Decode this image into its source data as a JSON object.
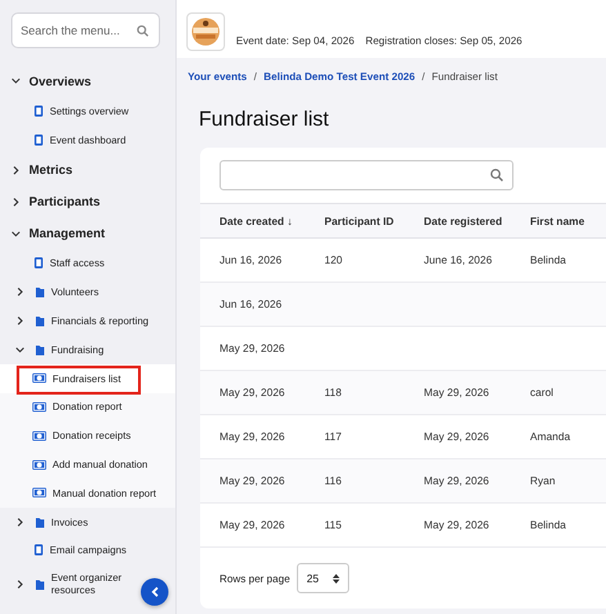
{
  "sidebar": {
    "search": {
      "placeholder": "Search the menu..."
    },
    "items": [
      {
        "label": "Overviews",
        "kind": "section",
        "expanded": true,
        "children": [
          {
            "label": "Settings overview",
            "kind": "link",
            "selected": false
          },
          {
            "label": "Event dashboard",
            "kind": "link",
            "selected": false
          }
        ]
      },
      {
        "label": "Metrics",
        "kind": "section",
        "expanded": false
      },
      {
        "label": "Participants",
        "kind": "section",
        "expanded": false
      },
      {
        "label": "Management",
        "kind": "section",
        "expanded": true,
        "children": [
          {
            "label": "Staff access",
            "kind": "link",
            "selected": false
          },
          {
            "label": "Volunteers",
            "kind": "group",
            "expanded": false
          },
          {
            "label": "Financials & reporting",
            "kind": "group",
            "expanded": false
          },
          {
            "label": "Fundraising",
            "kind": "group",
            "expanded": true,
            "children": [
              {
                "label": "Fundraisers list",
                "kind": "link",
                "selected": true
              },
              {
                "label": "Donation report",
                "kind": "link",
                "selected": false
              },
              {
                "label": "Donation receipts",
                "kind": "link",
                "selected": false
              },
              {
                "label": "Add manual donation",
                "kind": "link",
                "selected": false
              },
              {
                "label": "Manual donation report",
                "kind": "link",
                "selected": false
              }
            ]
          },
          {
            "label": "Invoices",
            "kind": "group",
            "expanded": false
          },
          {
            "label": "Email campaigns",
            "kind": "link",
            "selected": false
          },
          {
            "label": "Event organizer resources",
            "kind": "group",
            "expanded": false
          }
        ]
      }
    ]
  },
  "header": {
    "event_date": "Event date: Sep 04, 2026",
    "registration_closes": "Registration closes: Sep 05, 2026"
  },
  "breadcrumb_separator": "/",
  "breadcrumb": [
    {
      "label": "Your events",
      "link": true
    },
    {
      "label": "Belinda Demo Test Event 2026",
      "link": true
    },
    {
      "label": "Fundraiser list",
      "link": false
    }
  ],
  "title": "Fundraiser list",
  "table": {
    "columns": [
      "Date created ↓",
      "Participant ID",
      "Date registered",
      "First name"
    ],
    "rows": [
      [
        "Jun 16, 2026",
        "120",
        "June 16, 2026",
        "Belinda"
      ],
      [
        "Jun 16, 2026"
      ],
      [
        "May 29, 2026"
      ],
      [
        "May 29, 2026",
        "118",
        "May 29, 2026",
        "carol"
      ],
      [
        "May 29, 2026",
        "117",
        "May 29, 2026",
        "Amanda"
      ],
      [
        "May 29, 2026",
        "116",
        "May 29, 2026",
        "Ryan"
      ],
      [
        "May 29, 2026",
        "115",
        "May 29, 2026",
        "Belinda"
      ]
    ]
  },
  "pagination": {
    "label": "Rows per page",
    "value": "25"
  }
}
